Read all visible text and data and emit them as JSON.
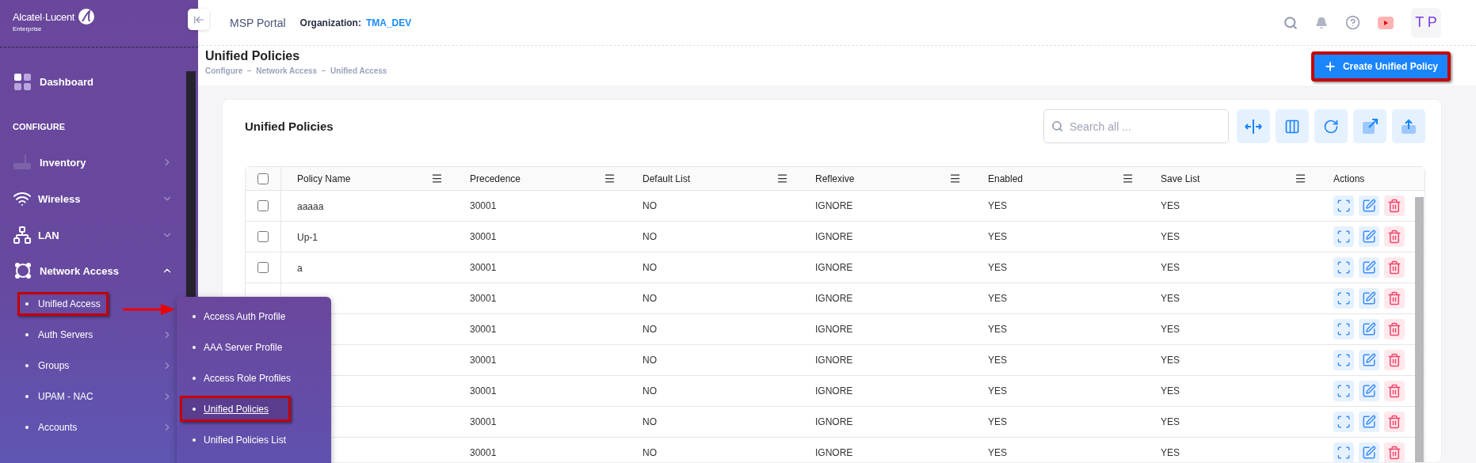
{
  "brand": {
    "name": "Alcatel·Lucent",
    "sub": "Enterprise"
  },
  "topbar": {
    "portal": "MSP Portal",
    "org_label": "Organization:",
    "org_value": "TMA_DEV",
    "avatar": "T P"
  },
  "sidebar": {
    "items": [
      {
        "kind": "link",
        "label": "Dashboard"
      },
      {
        "kind": "heading",
        "label": "CONFIGURE"
      },
      {
        "kind": "menu",
        "label": "Inventory"
      },
      {
        "kind": "group",
        "label": "Wireless",
        "expanded": false
      },
      {
        "kind": "group",
        "label": "LAN",
        "expanded": false
      },
      {
        "kind": "group",
        "label": "Network Access",
        "expanded": true,
        "children": [
          {
            "label": "Unified Access",
            "open": true,
            "highlighted": true
          },
          {
            "label": "Auth Servers",
            "open": false,
            "highlighted": false
          },
          {
            "label": "Groups",
            "open": false,
            "highlighted": false
          },
          {
            "label": "UPAM - NAC",
            "open": false,
            "highlighted": false
          },
          {
            "label": "Accounts",
            "open": false,
            "highlighted": false
          }
        ]
      }
    ]
  },
  "flyout": {
    "items": [
      {
        "label": "Access Auth Profile",
        "selected": false,
        "highlighted": false
      },
      {
        "label": "AAA Server Profile",
        "selected": false,
        "highlighted": false
      },
      {
        "label": "Access Role Profiles",
        "selected": false,
        "highlighted": false
      },
      {
        "label": "Unified Policies",
        "selected": true,
        "highlighted": true
      },
      {
        "label": "Unified Policies List",
        "selected": false,
        "highlighted": false
      }
    ]
  },
  "page": {
    "title": "Unified Policies",
    "breadcrumb": [
      "Configure",
      "Network Access",
      "Unified Access"
    ],
    "create_button": {
      "label": "Create Unified Policy",
      "highlighted": true
    }
  },
  "card": {
    "title": "Unified Policies",
    "search": {
      "placeholder": "Search all ..."
    },
    "select_all": {
      "checked": false
    },
    "columns": [
      "Policy Name",
      "Precedence",
      "Default List",
      "Reflexive",
      "Enabled",
      "Save List",
      "Actions"
    ],
    "rows": [
      {
        "checked": false,
        "name": "aaaaa",
        "precedence": "30001",
        "default_list": "NO",
        "reflexive": "IGNORE",
        "enabled": "YES",
        "save_list": "YES"
      },
      {
        "checked": false,
        "name": "Up-1",
        "precedence": "30001",
        "default_list": "NO",
        "reflexive": "IGNORE",
        "enabled": "YES",
        "save_list": "YES"
      },
      {
        "checked": false,
        "name": "a",
        "precedence": "30001",
        "default_list": "NO",
        "reflexive": "IGNORE",
        "enabled": "YES",
        "save_list": "YES"
      },
      {
        "precedence": "30001",
        "default_list": "NO",
        "reflexive": "IGNORE",
        "enabled": "YES",
        "save_list": "YES"
      },
      {
        "precedence": "30001",
        "default_list": "NO",
        "reflexive": "IGNORE",
        "enabled": "YES",
        "save_list": "YES"
      },
      {
        "precedence": "30001",
        "default_list": "NO",
        "reflexive": "IGNORE",
        "enabled": "YES",
        "save_list": "YES"
      },
      {
        "precedence": "30001",
        "default_list": "NO",
        "reflexive": "IGNORE",
        "enabled": "YES",
        "save_list": "YES"
      },
      {
        "precedence": "30001",
        "default_list": "NO",
        "reflexive": "IGNORE",
        "enabled": "YES",
        "save_list": "YES"
      },
      {
        "precedence": "30001",
        "default_list": "NO",
        "reflexive": "IGNORE",
        "enabled": "YES",
        "save_list": "YES"
      }
    ]
  }
}
